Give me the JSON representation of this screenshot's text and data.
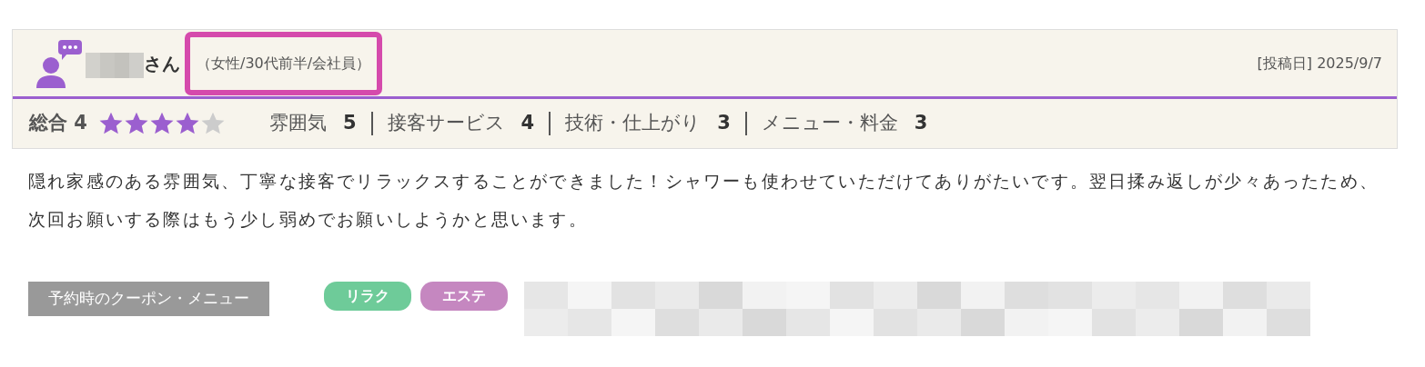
{
  "reviewer": {
    "name_suffix": "さん",
    "profile": "（女性/30代前半/会社員）",
    "highlighted": true
  },
  "posted": "[投稿日] 2025/9/7",
  "overall": {
    "label": "総合",
    "score": "4",
    "stars": 4
  },
  "ratings": [
    {
      "label": "雰囲気",
      "score": "5"
    },
    {
      "label": "接客サービス",
      "score": "4"
    },
    {
      "label": "技術・仕上がり",
      "score": "3"
    },
    {
      "label": "メニュー・料金",
      "score": "3"
    }
  ],
  "body": "隠れ家感のある雰囲気、丁寧な接客でリラックスすることができました！シャワーも使わせていただけてありがたいです。翌日揉み返しが少々あったため、次回お願いする際はもう少し弱めでお願いしようかと思います。",
  "coupon": {
    "label": "予約時のクーポン・メニュー",
    "tags": [
      {
        "text": "リラク",
        "color": "#6ecb99"
      },
      {
        "text": "エステ",
        "color": "#c587c0"
      }
    ]
  }
}
